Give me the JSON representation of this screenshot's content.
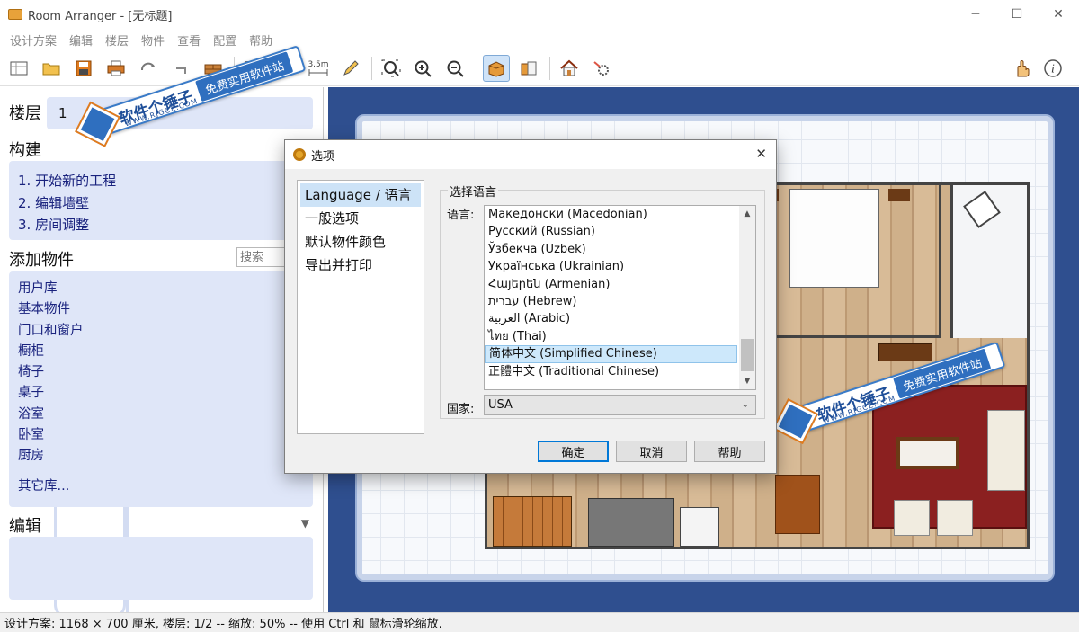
{
  "window": {
    "title": "Room Arranger - [无标题]",
    "controls": {
      "minimize": "─",
      "maximize": "☐",
      "close": "✕"
    }
  },
  "menu": [
    "设计方案",
    "编辑",
    "楼层",
    "物件",
    "查看",
    "配置",
    "帮助"
  ],
  "toolbar": {
    "scale_label": "3.5m",
    "buttons": [
      "new-icon",
      "open-icon",
      "save-icon",
      "print-icon",
      "rotate-icon",
      "undo-icon",
      "wall-icon",
      "select-icon",
      "move-icon",
      "measure-icon",
      "draw-icon",
      "zoom-fit-icon",
      "zoom-in-icon",
      "zoom-out-icon",
      "view-2d-icon",
      "view-3d-icon",
      "house-icon",
      "tools-icon",
      "hand-icon",
      "info-icon"
    ]
  },
  "left_panel": {
    "floor_label": "楼层",
    "floor_value": "1",
    "build_heading": "构建",
    "build_steps": [
      "1. 开始新的工程",
      "2. 编辑墙壁",
      "3. 房间调整"
    ],
    "add_heading": "添加物件",
    "search_placeholder": "搜索",
    "object_categories": [
      {
        "label": "用户库",
        "arrow": ">"
      },
      {
        "label": "基本物件",
        "arrow": ">"
      },
      {
        "label": "门口和窗户",
        "arrow": ">"
      },
      {
        "label": "橱柜",
        "arrow": ">"
      },
      {
        "label": "椅子",
        "arrow": ">"
      },
      {
        "label": "桌子",
        "arrow": ">"
      },
      {
        "label": "浴室",
        "arrow": ">"
      },
      {
        "label": "卧室",
        "arrow": ">"
      },
      {
        "label": "厨房",
        "arrow": ">"
      }
    ],
    "other_libraries": "其它库...",
    "edit_heading": "编辑",
    "edit_collapse": "▼"
  },
  "dialog": {
    "title": "选项",
    "close": "✕",
    "nav": [
      "Language / 语言",
      "一般选项",
      "默认物件颜色",
      "导出并打印"
    ],
    "selected_nav": 0,
    "group_title": "选择语言",
    "language_label": "语言:",
    "languages": [
      "Македонски (Macedonian)",
      "Русский (Russian)",
      "Ўзбекча (Uzbek)",
      "Українська (Ukrainian)",
      "Հայերեն (Armenian)",
      "עברית (Hebrew)",
      "العربية (Arabic)",
      "ไทย (Thai)",
      "简体中文 (Simplified Chinese)",
      "正體中文 (Traditional Chinese)"
    ],
    "selected_language": "简体中文 (Simplified Chinese)",
    "scroll_up": "▲",
    "scroll_down": "▼",
    "country_label": "国家:",
    "country_value": "USA",
    "country_caret": "⌄",
    "buttons": {
      "ok": "确定",
      "cancel": "取消",
      "help": "帮助"
    }
  },
  "watermark": {
    "main": "软件个锤子",
    "sub": "WWW.RJGCZ.COM",
    "tag": "免费实用软件站"
  },
  "statusbar": "设计方案: 1168 × 700 厘米, 楼层: 1/2 -- 缩放: 50% -- 使用 Ctrl 和 鼠标滑轮缩放.",
  "colors": {
    "canvas_background": "#2f4f8f",
    "panel_accent": "#dfe6f8",
    "link_text": "#1a237e",
    "selection": "#cde8fb",
    "default_button_border": "#0078d7",
    "rug": "#8b2020"
  }
}
